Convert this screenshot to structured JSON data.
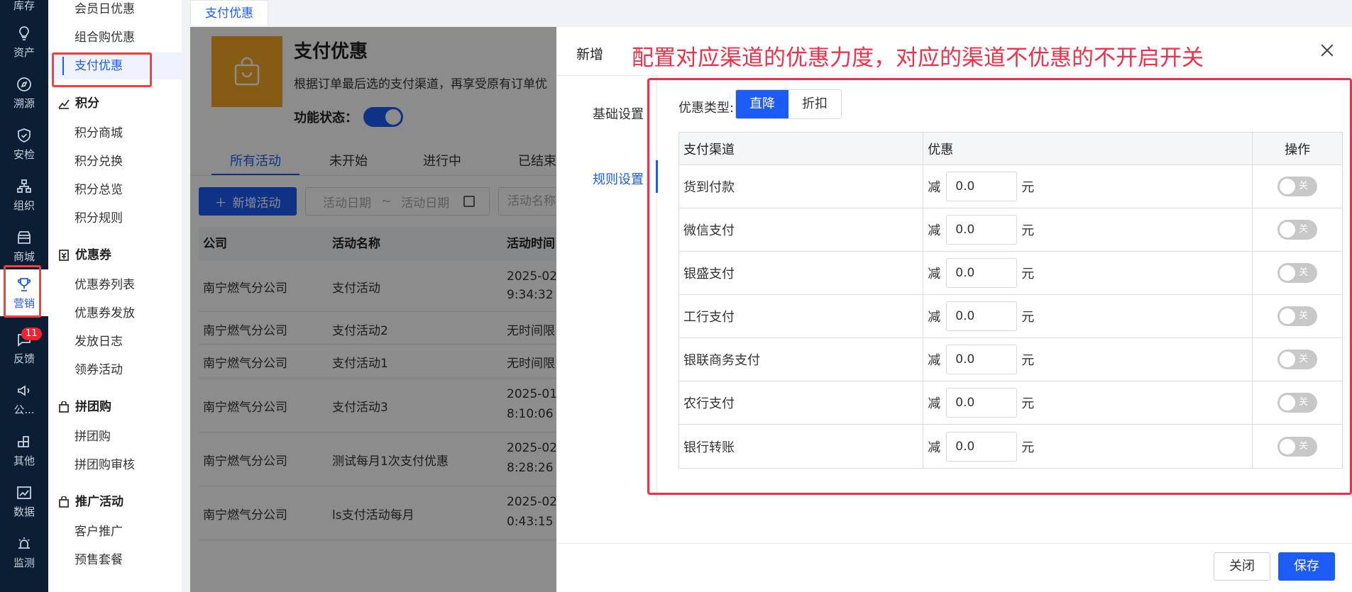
{
  "rail": {
    "items": [
      {
        "label": "库存",
        "icon": "box-icon"
      },
      {
        "label": "资产",
        "icon": "bulb-icon"
      },
      {
        "label": "溯源",
        "icon": "compass-icon"
      },
      {
        "label": "安检",
        "icon": "shield-check-icon"
      },
      {
        "label": "组织",
        "icon": "org-tree-icon"
      },
      {
        "label": "商城",
        "icon": "store-icon"
      },
      {
        "label": "营销",
        "icon": "trophy-icon",
        "active": true
      },
      {
        "label": "反馈",
        "icon": "chat-icon",
        "badge": "11"
      },
      {
        "label": "公...",
        "icon": "megaphone-icon"
      },
      {
        "label": "其他",
        "icon": "apps-icon"
      },
      {
        "label": "数据",
        "icon": "chart-icon"
      },
      {
        "label": "监测",
        "icon": "alarm-icon"
      }
    ]
  },
  "menu": {
    "items_top": [
      "会员日优惠",
      "组合购优惠",
      "支付优惠"
    ],
    "groups": [
      {
        "title": "积分",
        "items": [
          "积分商城",
          "积分兑换",
          "积分总览",
          "积分规则"
        ]
      },
      {
        "title": "优惠券",
        "items": [
          "优惠券列表",
          "优惠券发放",
          "发放日志",
          "领券活动"
        ]
      },
      {
        "title": "拼团购",
        "items": [
          "拼团购",
          "拼团购审核"
        ]
      },
      {
        "title": "推广活动",
        "items": [
          "客户推广",
          "预售套餐"
        ]
      }
    ]
  },
  "page_tab": "支付优惠",
  "hero": {
    "title": "支付优惠",
    "desc": "根据订单最后选的支付渠道，再享受原有订单优",
    "status_label": "功能状态："
  },
  "filter_tabs": [
    "所有活动",
    "未开始",
    "进行中",
    "已结束"
  ],
  "toolbar": {
    "add_label": "新增活动",
    "date_start": "活动日期",
    "date_sep": "~",
    "date_end": "活动日期",
    "name_placeholder": "活动名称"
  },
  "table": {
    "headers": [
      "公司",
      "活动名称",
      "活动时间"
    ],
    "rows": [
      {
        "company": "南宁燃气分公司",
        "name": "支付活动",
        "time1": "2025-02-",
        "time2": "9:34:32"
      },
      {
        "company": "南宁燃气分公司",
        "name": "支付活动2",
        "time1": "无时间限",
        "time2": ""
      },
      {
        "company": "南宁燃气分公司",
        "name": "支付活动1",
        "time1": "无时间限",
        "time2": ""
      },
      {
        "company": "南宁燃气分公司",
        "name": "支付活动3",
        "time1": "2025-01-",
        "time2": "8:10:06"
      },
      {
        "company": "南宁燃气分公司",
        "name": "测试每月1次支付优惠",
        "time1": "2025-02-",
        "time2": "8:28:26"
      },
      {
        "company": "南宁燃气分公司",
        "name": "ls支付活动每月",
        "time1": "2025-02-",
        "time2": "0:43:15"
      }
    ]
  },
  "drawer": {
    "title": "新增",
    "annotation": "配置对应渠道的优惠力度，对应的渠道不优惠的不开启开关",
    "nav": [
      "基础设置",
      "规则设置"
    ],
    "discount_type_label": "优惠类型:",
    "discount_types": [
      "直降",
      "折扣"
    ],
    "rules_headers": [
      "支付渠道",
      "优惠",
      "操作"
    ],
    "reduce_prefix": "减",
    "unit": "元",
    "switch_off_label": "关",
    "channels": [
      {
        "name": "货到付款",
        "value": "0.0"
      },
      {
        "name": "微信支付",
        "value": "0.0"
      },
      {
        "name": "银盛支付",
        "value": "0.0"
      },
      {
        "name": "工行支付",
        "value": "0.0"
      },
      {
        "name": "银联商务支付",
        "value": "0.0"
      },
      {
        "name": "农行支付",
        "value": "0.0"
      },
      {
        "name": "银行转账",
        "value": "0.0"
      }
    ],
    "close_label": "关闭",
    "save_label": "保存"
  }
}
